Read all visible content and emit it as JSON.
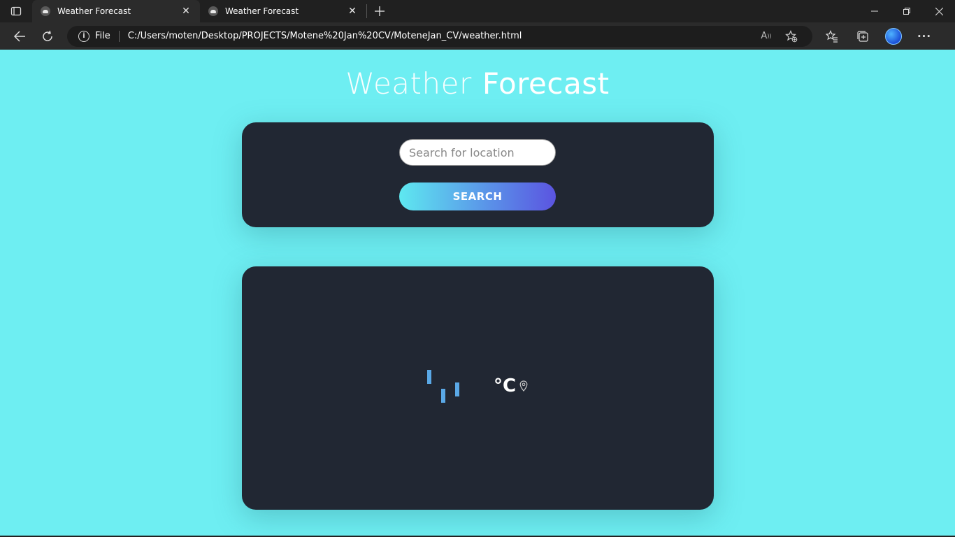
{
  "browser": {
    "tabs": [
      {
        "title": "Weather Forecast",
        "active": true
      },
      {
        "title": "Weather Forecast",
        "active": false
      }
    ],
    "address": {
      "scheme_label": "File",
      "url": "C:/Users/moten/Desktop/PROJECTS/Motene%20Jan%20CV/MoteneJan_CV/weather.html"
    }
  },
  "page": {
    "title_part1": "Weather",
    "title_part2": "Forecast",
    "search": {
      "placeholder": "Search for location",
      "button_label": "SEARCH"
    },
    "weather": {
      "temperature_unit": "°C"
    }
  },
  "colors": {
    "page_bg": "#6eeef2",
    "card_bg": "#212733",
    "button_gradient_start": "#5ee8f0",
    "button_gradient_end": "#5b54e0",
    "loader": "#5aa8e6"
  }
}
